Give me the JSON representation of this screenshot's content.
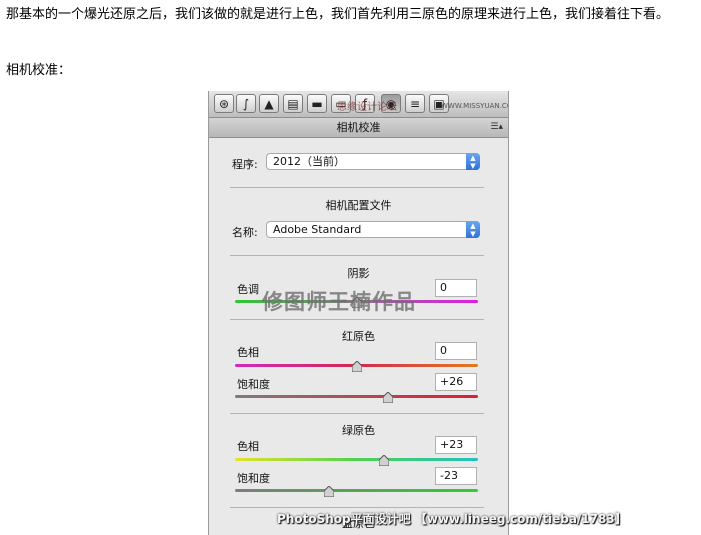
{
  "article": {
    "paragraph": "那基本的一个爆光还原之后，我们该做的就是进行上色，我们首先利用三原色的原理来进行上色，我们接着往下看。",
    "subheading": "相机校准："
  },
  "toolbar": {
    "tools": [
      "aperture-icon",
      "tone-curve-icon",
      "detail-icon",
      "hsl-icon",
      "split-toning-icon",
      "lens-icon",
      "fx-icon",
      "camera-calibration-icon",
      "presets-icon",
      "snapshots-icon"
    ],
    "watermark_text": "思缘设计论坛",
    "watermark_url": "WWW.MISSYUAN.COM"
  },
  "panel": {
    "title": "相机校准",
    "process_label": "程序:",
    "process_value": "2012（当前）",
    "profile_heading": "相机配置文件",
    "name_label": "名称:",
    "name_value": "Adobe Standard",
    "shadows_heading": "阴影",
    "shadows_tint_label": "色调",
    "shadows_tint_value": "0",
    "red_heading": "红原色",
    "red_hue_label": "色相",
    "red_hue_value": "0",
    "red_sat_label": "饱和度",
    "red_sat_value": "+26",
    "green_heading": "绿原色",
    "green_hue_label": "色相",
    "green_hue_value": "+23",
    "green_sat_label": "饱和度",
    "green_sat_value": "-23",
    "blue_heading": "蓝原色",
    "slider_levels": {
      "shadows_tint": 0,
      "red_hue": 0,
      "red_sat": 26,
      "green_hue": 23,
      "green_sat": -23
    }
  },
  "watermarks": {
    "center": "修图师王楠作品",
    "bottom": "PhotoShop平面设计吧 【www.lineeg.com/tieba/1783】"
  },
  "colors": {
    "accent_blue": "#2f72d8",
    "panel_bg": "#e9e9e9"
  }
}
